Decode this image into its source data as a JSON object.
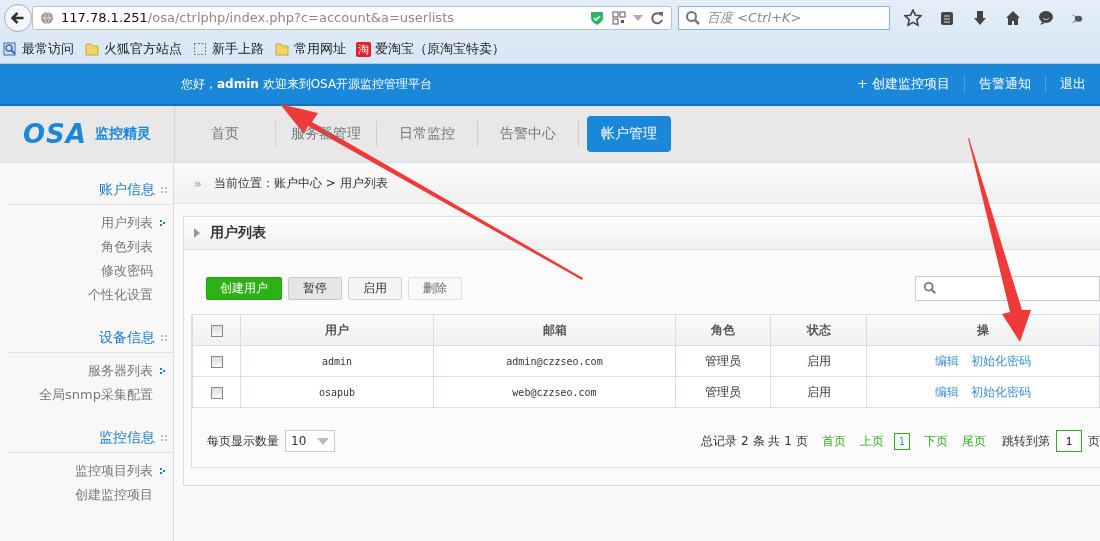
{
  "browser": {
    "url_host": "117.78.1.251",
    "url_path": "/osa/ctrlphp/index.php?c=account&a=userlists",
    "search_placeholder": "百度 <Ctrl+K>",
    "bookmarks": [
      {
        "label": "最常访问",
        "kind": "frequent"
      },
      {
        "label": "火狐官方站点",
        "kind": "folder"
      },
      {
        "label": "新手上路",
        "kind": "dashed"
      },
      {
        "label": "常用网址",
        "kind": "folder"
      },
      {
        "label": "爱淘宝（原淘宝特卖）",
        "kind": "badge",
        "badge": "淘"
      }
    ]
  },
  "header": {
    "greeting": "您好，**admin** 欢迎来到OSA开源监控管理平台",
    "links": [
      "+ 创建监控项目",
      "告警通知",
      "退出"
    ]
  },
  "logo": {
    "mark": "OSA",
    "name": "监控精灵"
  },
  "nav": [
    {
      "label": "首页",
      "selected": false
    },
    {
      "label": "服务器管理",
      "selected": false
    },
    {
      "label": "日常监控",
      "selected": false
    },
    {
      "label": "告警中心",
      "selected": false
    },
    {
      "label": "帐户管理",
      "selected": true
    }
  ],
  "sidebar": {
    "sections": [
      {
        "title": "账户信息",
        "items": [
          {
            "label": "用户列表",
            "kind": "arrow"
          },
          {
            "label": "角色列表",
            "kind": "plain"
          },
          {
            "label": "修改密码",
            "kind": "plain"
          },
          {
            "label": "个性化设置",
            "kind": "plain"
          }
        ]
      },
      {
        "title": "设备信息",
        "items": [
          {
            "label": "服务器列表",
            "kind": "arrow"
          },
          {
            "label": "全局snmp采集配置",
            "kind": "plain"
          }
        ]
      },
      {
        "title": "监控信息",
        "items": [
          {
            "label": "监控项目列表",
            "kind": "arrow"
          },
          {
            "label": "创建监控项目",
            "kind": "plain"
          }
        ]
      }
    ]
  },
  "breadcrumb": {
    "separator": "»",
    "text": "当前位置：账户中心 > 用户列表"
  },
  "panel": {
    "title": "用户列表",
    "buttons": [
      {
        "label": "创建用户",
        "kind": "primary"
      },
      {
        "label": "暂停",
        "kind": "pressed"
      },
      {
        "label": "启用",
        "kind": "normal"
      },
      {
        "label": "删除",
        "kind": "muted"
      }
    ],
    "table": {
      "header_checked": false,
      "columns": [
        "用户",
        "邮箱",
        "角色",
        "状态",
        "操"
      ],
      "rows": [
        {
          "checked": false,
          "user": "admin",
          "email": "admin@czzseo.com",
          "role": "管理员",
          "status": "启用",
          "actions": [
            "编辑",
            "初始化密码"
          ]
        },
        {
          "checked": false,
          "user": "osapub",
          "email": "web@czzseo.com",
          "role": "管理员",
          "status": "启用",
          "actions": [
            "编辑",
            "初始化密码"
          ]
        }
      ]
    },
    "pagination": {
      "page_size_label": "每页显示数量",
      "page_size": "10",
      "summary": "总记录 2 条  共 1 页",
      "pages": [
        {
          "label": "首页",
          "kind": "link"
        },
        {
          "label": "上页",
          "kind": "link"
        },
        {
          "label": "1",
          "kind": "current"
        },
        {
          "label": "下页",
          "kind": "link"
        },
        {
          "label": "尾页",
          "kind": "link"
        }
      ],
      "jump_label": "跳转到第",
      "jump_value": "1",
      "jump_suffix": "页"
    }
  }
}
